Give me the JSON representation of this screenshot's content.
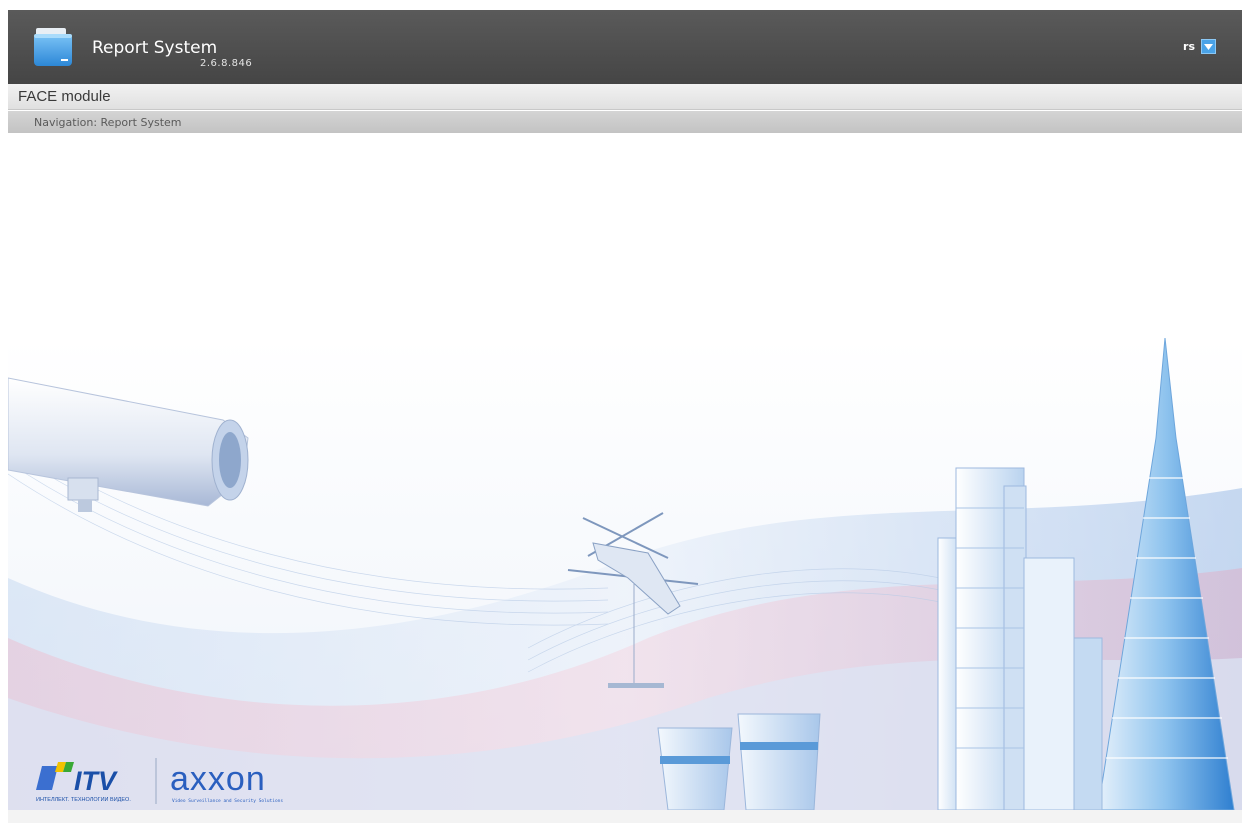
{
  "header": {
    "title": "Report System",
    "version": "2.6.8.846",
    "user": "rs",
    "logo_icon": "folder-icon",
    "dropdown_icon": "chevron-down-icon"
  },
  "module": {
    "title": "FACE module"
  },
  "navigation": {
    "text": "Navigation: Report System"
  },
  "branding": {
    "itv_name": "ITV",
    "itv_tagline": "ИНТЕЛЛЕКТ. ТЕХНОЛОГИИ ВИДЕО.",
    "axxon_name": "axxon",
    "axxon_tagline": "Video Surveillance and Security Solutions"
  },
  "colors": {
    "header": "#4b4b4b",
    "accent": "#4aa3e8",
    "module_bar": "#e6e6e6",
    "nav_bar": "#c8c8c8"
  }
}
